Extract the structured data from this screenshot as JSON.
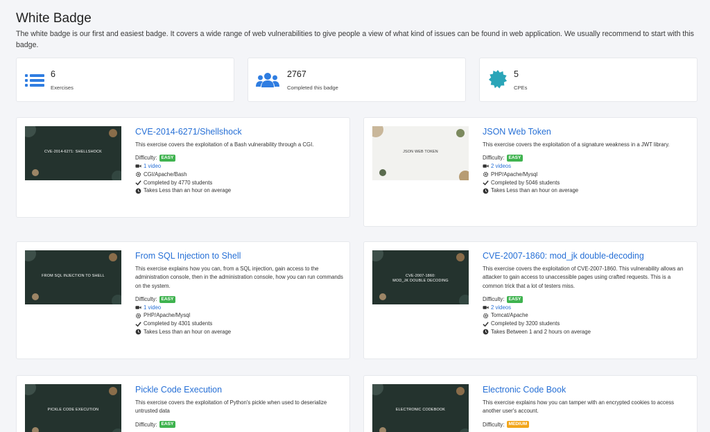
{
  "page": {
    "title": "White Badge",
    "description": "The white badge is our first and easiest badge. It covers a wide range of web vulnerabilities to give people a view of what kind of issues can be found in web application. We usually recommend to start with this badge."
  },
  "stats": [
    {
      "value": "6",
      "label": "Exercises",
      "icon": "list-icon"
    },
    {
      "value": "2767",
      "label": "Completed this badge",
      "icon": "users-icon"
    },
    {
      "value": "5",
      "label": "CPEs",
      "icon": "certificate-icon"
    }
  ],
  "colors": {
    "accent": "#2770d6",
    "easy": "#3fb34f",
    "medium": "#f2a51a",
    "icon": "#2f7de1"
  },
  "exercises": [
    {
      "title": "CVE-2014-6271/Shellshock",
      "thumb_label": "CVE-2014-6271: SHELLSHOCK",
      "description": "This exercise covers the exploitation of a Bash vulnerability through a CGI.",
      "difficulty_label": "Difficulty:",
      "difficulty": "EASY",
      "videos": "1 video",
      "stack": "CGI/Apache/Bash",
      "completed": "Completed by 4770 students",
      "time": "Takes Less than an hour on average"
    },
    {
      "title": "JSON Web Token",
      "thumb_label": "JSON WEB TOKEN",
      "description": "This exercise covers the exploitation of a signature weakness in a JWT library.",
      "difficulty_label": "Difficulty:",
      "difficulty": "EASY",
      "videos": "2 videos",
      "stack": "PHP/Apache/Mysql",
      "completed": "Completed by 5046 students",
      "time": "Takes Less than an hour on average"
    },
    {
      "title": "From SQL Injection to Shell",
      "thumb_label": "FROM SQL INJECTION TO SHELL",
      "description": "This exercise explains how you can, from a SQL injection, gain access to the administration console, then in the administration console, how you can run commands on the system.",
      "difficulty_label": "Difficulty:",
      "difficulty": "EASY",
      "videos": "1 video",
      "stack": "PHP/Apache/Mysql",
      "completed": "Completed by 4301 students",
      "time": "Takes Less than an hour on average"
    },
    {
      "title": "CVE-2007-1860: mod_jk double-decoding",
      "thumb_label": "CVE-2007-1860:\nMOD_JK DOUBLE DECODING",
      "description": "This exercise covers the exploitation of CVE-2007-1860. This vulnerability allows an attacker to gain access to unaccessible pages using crafted requests. This is a common trick that a lot of testers miss.",
      "difficulty_label": "Difficulty:",
      "difficulty": "EASY",
      "videos": "2 videos",
      "stack": "Tomcat/Apache",
      "completed": "Completed by 3200 students",
      "time": "Takes Between 1 and 2 hours on average"
    },
    {
      "title": "Pickle Code Execution",
      "thumb_label": "PICKLE CODE EXECUTION",
      "description": "This exercise covers the exploitation of Python's pickle when used to deserialize untrusted data",
      "difficulty_label": "Difficulty:",
      "difficulty": "EASY"
    },
    {
      "title": "Electronic Code Book",
      "thumb_label": "ELECTRONIC CODEBOOK",
      "description": "This exercise explains how you can tamper with an encrypted cookies to access another user's account.",
      "difficulty_label": "Difficulty:",
      "difficulty": "MEDIUM"
    }
  ]
}
